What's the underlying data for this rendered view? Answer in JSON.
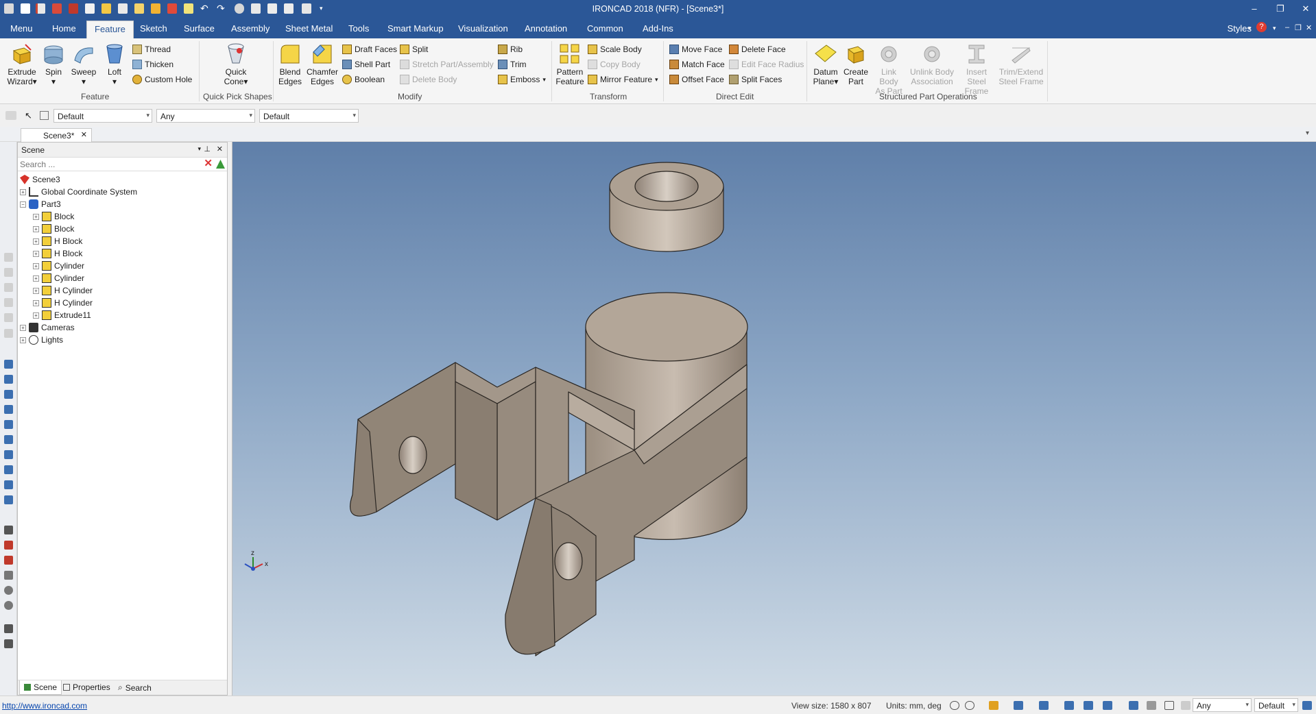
{
  "window": {
    "title": "IRONCAD 2018 (NFR) - [Scene3*]"
  },
  "tabs": [
    "Menu",
    "Home",
    "Feature",
    "Sketch",
    "Surface",
    "Assembly",
    "Sheet Metal",
    "Tools",
    "Smart Markup",
    "Visualization",
    "Annotation",
    "Common",
    "Add-Ins"
  ],
  "styles_label": "Styles",
  "ribbon": {
    "feature": {
      "group": "Feature",
      "extrude": [
        "Extrude",
        "Wizard"
      ],
      "spin": "Spin",
      "sweep": "Sweep",
      "loft": "Loft",
      "thread": "Thread",
      "thicken": "Thicken",
      "custom_hole": "Custom Hole"
    },
    "quick_pick": {
      "group": "Quick Pick Shapes",
      "quick_cone": [
        "Quick",
        "Cone"
      ]
    },
    "modify": {
      "group": "Modify",
      "blend": [
        "Blend",
        "Edges"
      ],
      "chamfer": [
        "Chamfer",
        "Edges"
      ],
      "draft_faces": "Draft Faces",
      "shell_part": "Shell Part",
      "boolean": "Boolean",
      "split": "Split",
      "stretch": "Stretch Part/Assembly",
      "delete_body": "Delete Body",
      "rib": "Rib",
      "trim": "Trim",
      "emboss": "Emboss"
    },
    "transform": {
      "group": "Transform",
      "pattern": [
        "Pattern",
        "Feature"
      ],
      "scale_body": "Scale Body",
      "copy_body": "Copy Body",
      "mirror_feature": "Mirror Feature"
    },
    "direct_edit": {
      "group": "Direct Edit",
      "move_face": "Move Face",
      "match_face": "Match Face",
      "offset_face": "Offset Face",
      "delete_face": "Delete Face",
      "edit_face_radius": "Edit Face Radius",
      "split_faces": "Split Faces"
    },
    "structured": {
      "group": "Structured Part Operations",
      "datum_plane": [
        "Datum",
        "Plane"
      ],
      "create_part": [
        "Create",
        "Part"
      ],
      "link_body": [
        "Link Body",
        "As Part"
      ],
      "unlink_body": [
        "Unlink Body",
        "Association"
      ],
      "insert_steel": [
        "Insert Steel",
        "Frame"
      ],
      "trim_extend": [
        "Trim/Extend",
        "Steel Frame"
      ]
    }
  },
  "toolbar": {
    "combo1": "Default",
    "combo2": "Any",
    "combo3": "Default"
  },
  "doc_tab": "Scene3*",
  "panel": {
    "title": "Scene",
    "search_placeholder": "Search ...",
    "tree": [
      "Scene3",
      "Global Coordinate System",
      "Part3",
      "Block",
      "Block",
      "H Block",
      "H Block",
      "Cylinder",
      "Cylinder",
      "H Cylinder",
      "H Cylinder",
      "Extrude11",
      "Cameras",
      "Lights"
    ],
    "footer_tabs": [
      "Scene",
      "Properties",
      "Search"
    ]
  },
  "triad": {
    "x": "x",
    "z": "z"
  },
  "status": {
    "url": "http://www.ironcad.com",
    "view_size": "View size: 1580 x 807",
    "units": "Units: mm, deg",
    "combo_any": "Any",
    "combo_default": "Default"
  },
  "colors": {
    "accent": "#2b5797",
    "part": "#a19485",
    "viewport_top": "#5f7fa9",
    "viewport_bottom": "#cfdbe6"
  }
}
